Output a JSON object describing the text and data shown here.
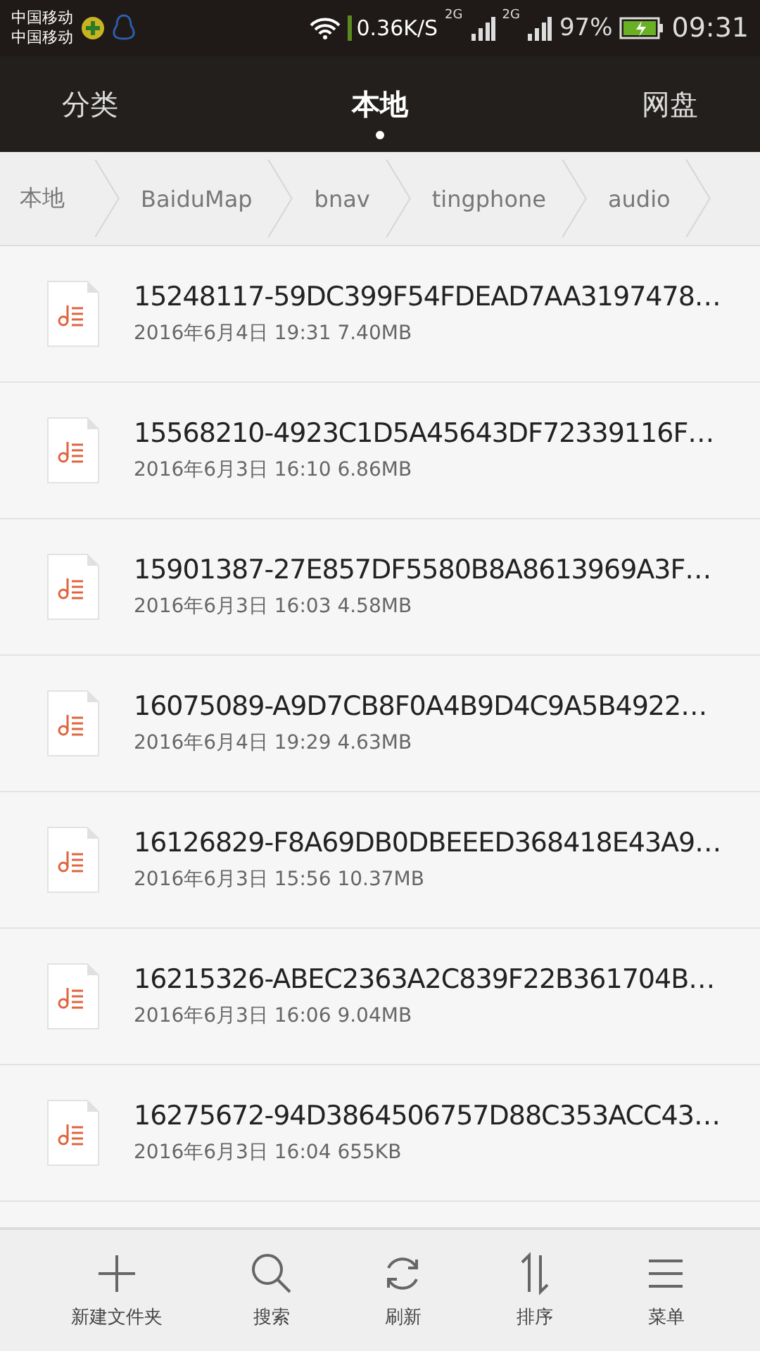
{
  "status_bar": {
    "carriers": [
      "中国移动",
      "中国移动"
    ],
    "speed": "0.36K/S",
    "network_1": "2G",
    "network_2": "2G",
    "battery": "97%",
    "time": "09:31"
  },
  "tabs": [
    {
      "label": "分类",
      "selected": false
    },
    {
      "label": "本地",
      "selected": true
    },
    {
      "label": "网盘",
      "selected": false
    }
  ],
  "breadcrumb": [
    "本地",
    "BaiduMap",
    "bnav",
    "tingphone",
    "audio"
  ],
  "files": [
    {
      "name": "15248117-59DC399F54FDEAD7AA3197478…",
      "date": "2016年6月4日 19:31",
      "size": "7.40MB"
    },
    {
      "name": "15568210-4923C1D5A45643DF72339116F…",
      "date": "2016年6月3日 16:10",
      "size": "6.86MB"
    },
    {
      "name": "15901387-27E857DF5580B8A8613969A3F…",
      "date": "2016年6月3日 16:03",
      "size": "4.58MB"
    },
    {
      "name": "16075089-A9D7CB8F0A4B9D4C9A5B4922…",
      "date": "2016年6月4日 19:29",
      "size": "4.63MB"
    },
    {
      "name": "16126829-F8A69DB0DBEEED368418E43A9…",
      "date": "2016年6月3日 15:56",
      "size": "10.37MB"
    },
    {
      "name": "16215326-ABEC2363A2C839F22B361704B…",
      "date": "2016年6月3日 16:06",
      "size": "9.04MB"
    },
    {
      "name": "16275672-94D3864506757D88C353ACC43…",
      "date": "2016年6月3日 16:04",
      "size": "655KB"
    }
  ],
  "toolbar": [
    {
      "kind": "plus",
      "label": "新建文件夹"
    },
    {
      "kind": "search",
      "label": "搜索"
    },
    {
      "kind": "refresh",
      "label": "刷新"
    },
    {
      "kind": "sort",
      "label": "排序"
    },
    {
      "kind": "menu",
      "label": "菜单"
    }
  ]
}
